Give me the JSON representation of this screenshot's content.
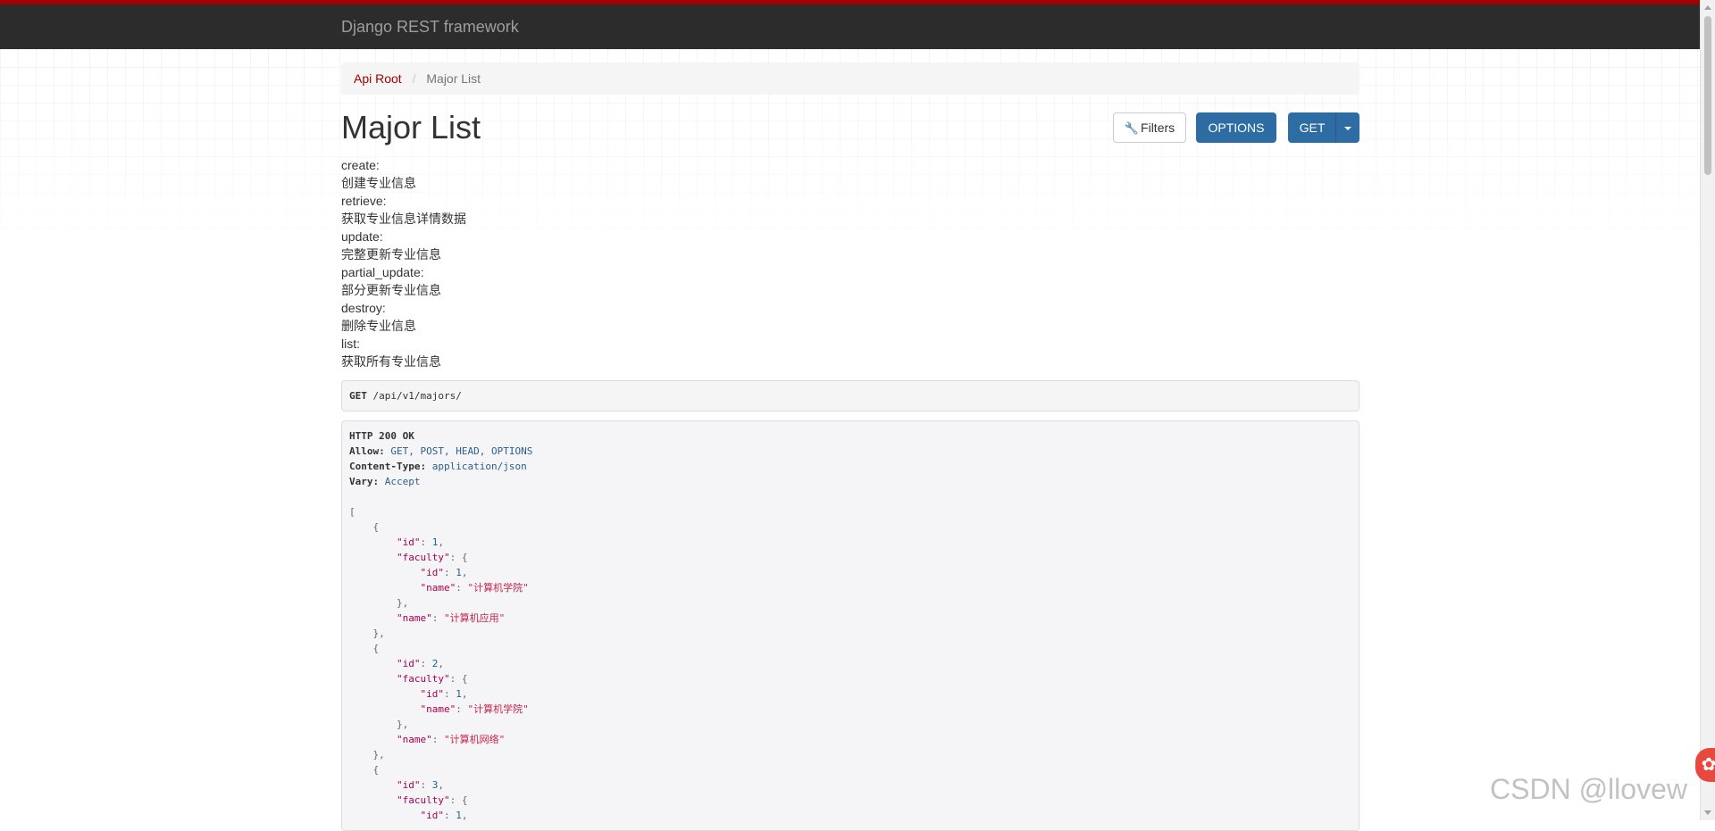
{
  "navbar": {
    "brand": "Django REST framework"
  },
  "breadcrumb": {
    "root": "Api Root",
    "separator": "/",
    "current": "Major List"
  },
  "page": {
    "title": "Major List"
  },
  "buttons": {
    "filters": "Filters",
    "options": "OPTIONS",
    "get": "GET"
  },
  "description": [
    "create:",
    "创建专业信息",
    "retrieve:",
    "获取专业信息详情数据",
    "update:",
    "完整更新专业信息",
    "partial_update:",
    "部分更新专业信息",
    "destroy:",
    "删除专业信息",
    "list:",
    "获取所有专业信息"
  ],
  "request": {
    "method": "GET",
    "path": "/api/v1/majors/"
  },
  "response": {
    "status": "HTTP 200 OK",
    "headers": [
      {
        "key": "Allow",
        "value": "GET, POST, HEAD, OPTIONS"
      },
      {
        "key": "Content-Type",
        "value": "application/json"
      },
      {
        "key": "Vary",
        "value": "Accept"
      }
    ],
    "body": [
      {
        "id": 1,
        "faculty": {
          "id": 1,
          "name": "计算机学院"
        },
        "name": "计算机应用"
      },
      {
        "id": 2,
        "faculty": {
          "id": 1,
          "name": "计算机学院"
        },
        "name": "计算机网络"
      },
      {
        "id": 3,
        "faculty": {
          "id": 1
        }
      }
    ]
  },
  "watermark": "CSDN @llovew",
  "colors": {
    "brand_red": "#a30000",
    "navbar": "#2c2c2c",
    "primary_button": "#2e6da4"
  }
}
